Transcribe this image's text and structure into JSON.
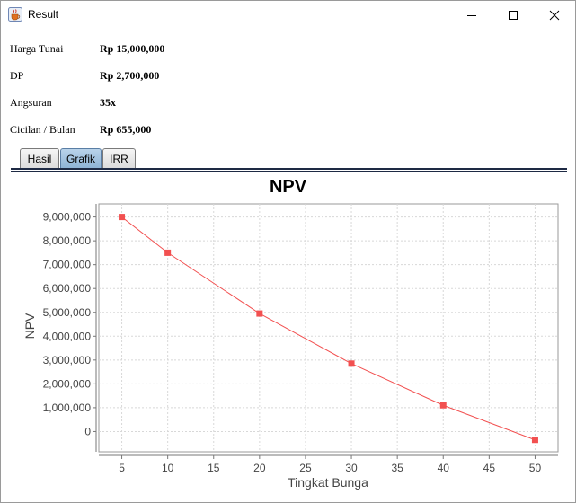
{
  "window": {
    "title": "Result",
    "icon": "java-cup-icon"
  },
  "info": [
    {
      "label": "Harga Tunai",
      "value": "Rp 15,000,000"
    },
    {
      "label": "DP",
      "value": "Rp 2,700,000"
    },
    {
      "label": "Angsuran",
      "value": "35x"
    },
    {
      "label": "Cicilan / Bulan",
      "value": "Rp 655,000"
    }
  ],
  "tabs": [
    {
      "label": "Hasil",
      "active": false
    },
    {
      "label": "Grafik",
      "active": true
    },
    {
      "label": "IRR",
      "active": false
    }
  ],
  "chart_data": {
    "type": "line",
    "title": "NPV",
    "xlabel": "Tingkat Bunga",
    "ylabel": "NPV",
    "x": [
      5,
      10,
      20,
      30,
      40,
      50
    ],
    "series": [
      {
        "values": [
          9000000,
          7500000,
          4950000,
          2850000,
          1100000,
          -350000
        ],
        "color": "#f25050"
      }
    ],
    "xlim": [
      2.5,
      52.5
    ],
    "ylim": [
      -850000,
      9550000
    ],
    "xticks": [
      5,
      10,
      15,
      20,
      25,
      30,
      35,
      40,
      45,
      50
    ],
    "yticks": [
      0,
      1000000,
      2000000,
      3000000,
      4000000,
      5000000,
      6000000,
      7000000,
      8000000,
      9000000
    ],
    "xtick_labels": [
      "5",
      "10",
      "15",
      "20",
      "25",
      "30",
      "35",
      "40",
      "45",
      "50"
    ],
    "ytick_labels": [
      "0",
      "1,000,000",
      "2,000,000",
      "3,000,000",
      "4,000,000",
      "5,000,000",
      "6,000,000",
      "7,000,000",
      "8,000,000",
      "9,000,000"
    ],
    "grid": true,
    "grid_color": "#d8d8d8",
    "marker": "square"
  }
}
